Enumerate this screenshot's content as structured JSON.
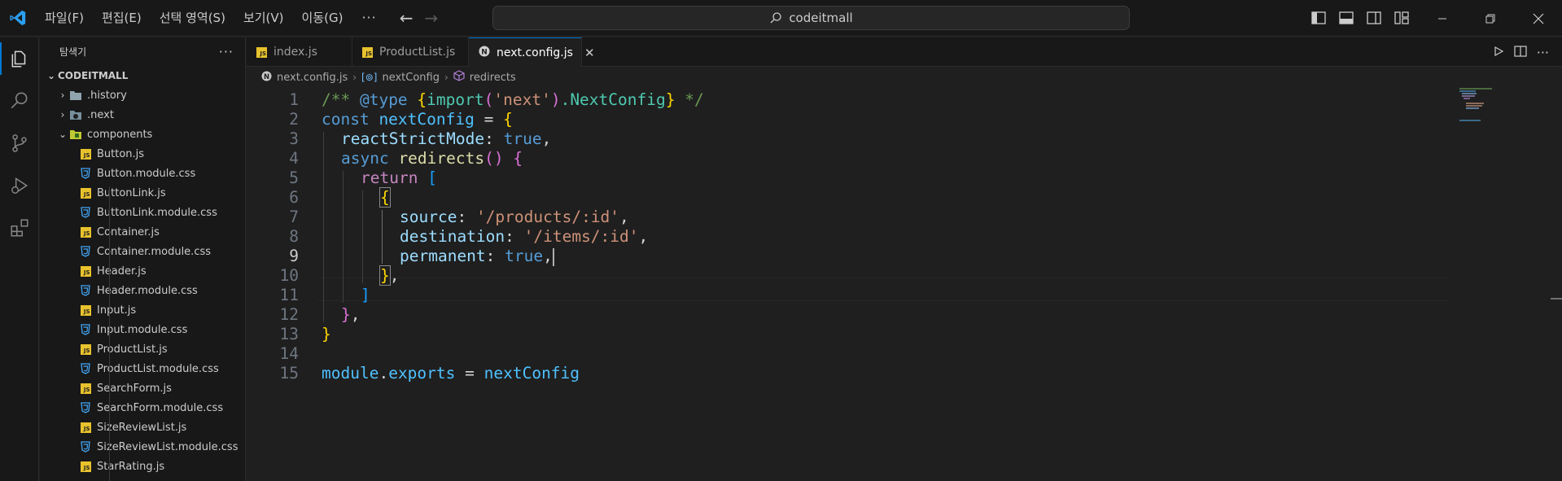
{
  "titlebar": {
    "menu": [
      "파일(F)",
      "편집(E)",
      "선택 영역(S)",
      "보기(V)",
      "이동(G)"
    ],
    "more": "···",
    "search_text": "codeitmall"
  },
  "sidebar": {
    "title": "탐색기",
    "more": "···",
    "section": "CODEITMALL",
    "folders": [
      {
        "label": ".history"
      },
      {
        "label": ".next"
      },
      {
        "label": "components"
      }
    ],
    "files": [
      {
        "label": "Button.js",
        "type": "js"
      },
      {
        "label": "Button.module.css",
        "type": "css"
      },
      {
        "label": "ButtonLink.js",
        "type": "js"
      },
      {
        "label": "ButtonLink.module.css",
        "type": "css"
      },
      {
        "label": "Container.js",
        "type": "js"
      },
      {
        "label": "Container.module.css",
        "type": "css"
      },
      {
        "label": "Header.js",
        "type": "js"
      },
      {
        "label": "Header.module.css",
        "type": "css"
      },
      {
        "label": "Input.js",
        "type": "js"
      },
      {
        "label": "Input.module.css",
        "type": "css"
      },
      {
        "label": "ProductList.js",
        "type": "js"
      },
      {
        "label": "ProductList.module.css",
        "type": "css"
      },
      {
        "label": "SearchForm.js",
        "type": "js"
      },
      {
        "label": "SearchForm.module.css",
        "type": "css"
      },
      {
        "label": "SizeReviewList.js",
        "type": "js"
      },
      {
        "label": "SizeReviewList.module.css",
        "type": "css"
      },
      {
        "label": "StarRating.js",
        "type": "js"
      }
    ]
  },
  "tabs": [
    {
      "label": "index.js",
      "active": false
    },
    {
      "label": "ProductList.js",
      "active": false
    },
    {
      "label": "next.config.js",
      "active": true
    }
  ],
  "breadcrumbs": {
    "file": "next.config.js",
    "symbol1": "nextConfig",
    "symbol2": "redirects"
  },
  "editor": {
    "current_line": 9,
    "line_numbers": [
      "1",
      "2",
      "3",
      "4",
      "5",
      "6",
      "7",
      "8",
      "9",
      "10",
      "11",
      "12",
      "13",
      "14",
      "15"
    ],
    "code": {
      "l1": {
        "a": "/** ",
        "b": "@type",
        "c": " ",
        "d": "{",
        "e": "import",
        "f": "(",
        "g": "'next'",
        "h": ")",
        "i": ".NextConfig",
        "j": "}",
        "k": " */"
      },
      "l2": {
        "a": "const",
        "b": " nextConfig",
        "c": " = ",
        "d": "{"
      },
      "l3": {
        "a": "reactStrictMode",
        "b": ": ",
        "c": "true",
        "d": ","
      },
      "l4": {
        "a": "async",
        "b": " redirects",
        "c": "()",
        "d": " ",
        "e": "{"
      },
      "l5": {
        "a": "return",
        "b": " ",
        "c": "["
      },
      "l6": {
        "a": "{"
      },
      "l7": {
        "a": "source",
        "b": ": ",
        "c": "'/products/:id'",
        "d": ","
      },
      "l8": {
        "a": "destination",
        "b": ": ",
        "c": "'/items/:id'",
        "d": ","
      },
      "l9": {
        "a": "permanent",
        "b": ": ",
        "c": "true",
        "d": ","
      },
      "l10": {
        "a": "}",
        "b": ","
      },
      "l11": {
        "a": "]"
      },
      "l12": {
        "a": "}",
        "b": ","
      },
      "l13": {
        "a": "}"
      },
      "l15": {
        "a": "module",
        "b": ".",
        "c": "exports",
        "d": " = ",
        "e": "nextConfig"
      }
    }
  }
}
